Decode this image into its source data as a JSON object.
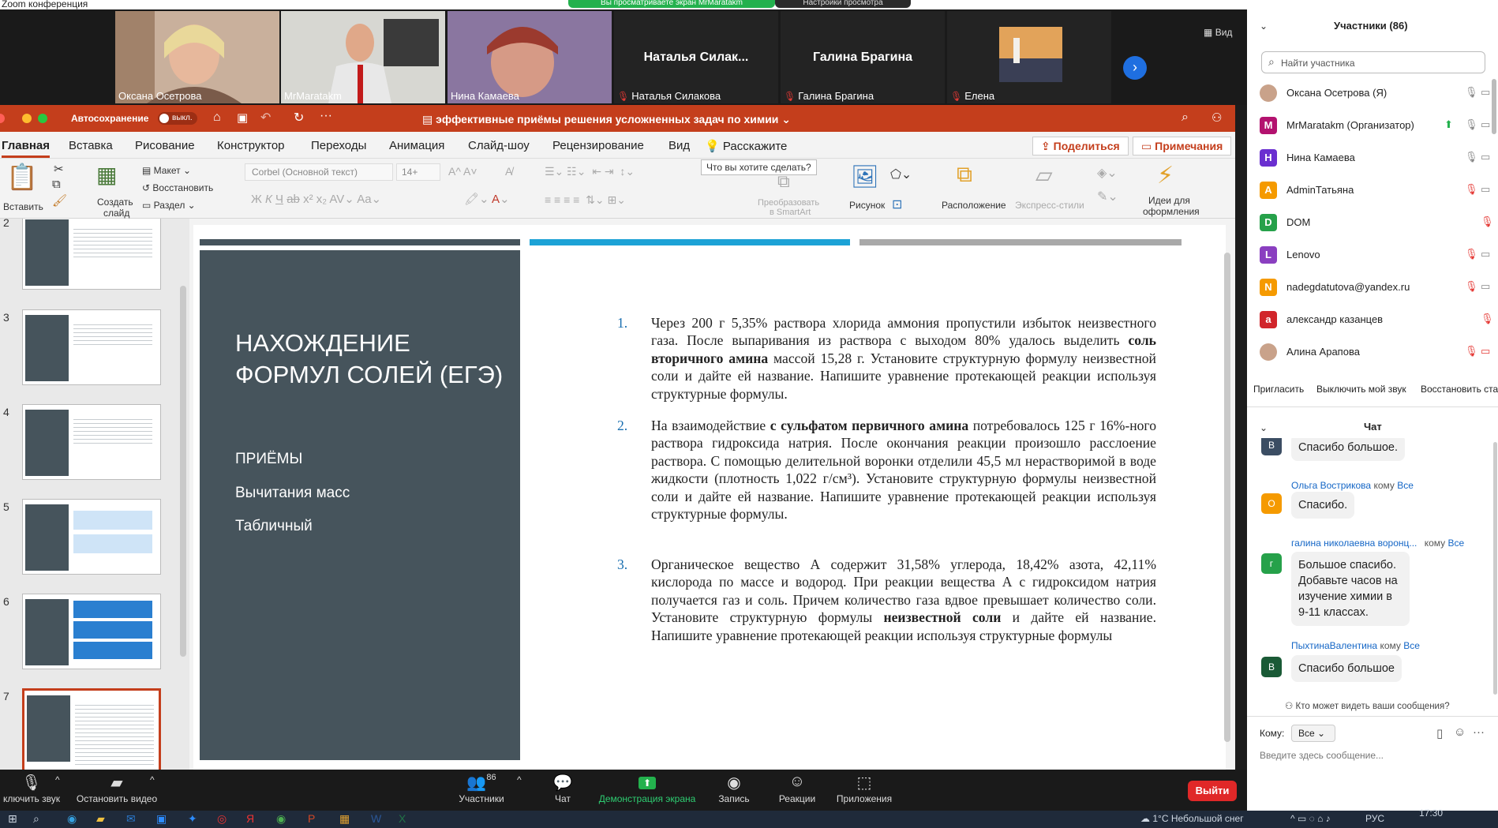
{
  "window": {
    "title": "Zoom конференция",
    "banner": "Вы просматриваете экран MrMaratakm",
    "view_settings": "Настройки просмотра"
  },
  "strip": {
    "view_label": "Вид",
    "tiles": [
      {
        "name": "Оксана Осетрова",
        "muted": false
      },
      {
        "name": "MrMaratakm",
        "muted": false
      },
      {
        "name": "Нина Камаева",
        "muted": false
      },
      {
        "name": "Наталья Силакова",
        "big": "Наталья  Силак...",
        "muted": true
      },
      {
        "name": "Галина Брагина",
        "big": "Галина Брагина",
        "muted": true
      },
      {
        "name": "Елена",
        "muted": true
      }
    ]
  },
  "ppt": {
    "autosave": "Автосохранение",
    "autosave_state": "выкл.",
    "doc_title": "эффективные приёмы решения усложненных задач по химии",
    "tabs": [
      "Главная",
      "Вставка",
      "Рисование",
      "Конструктор",
      "Переходы",
      "Анимация",
      "Слайд-шоу",
      "Рецензирование",
      "Вид",
      "Расскажите"
    ],
    "share": "Поделиться",
    "notes": "Примечания",
    "tooltip": "Что вы хотите сделать?",
    "toolbar": {
      "paste": "Вставить",
      "new_slide_1": "Создать",
      "new_slide_2": "слайд",
      "layout": "Макет",
      "reset": "Восстановить",
      "section": "Раздел",
      "font": "Corbel (Основной текст)",
      "size": "14+",
      "smartart_1": "Преобразовать",
      "smartart_2": "в SmartArt",
      "picture": "Рисунок",
      "arrange": "Расположение",
      "quick_styles": "Экспресс-стили",
      "design_1": "Идеи для",
      "design_2": "оформления"
    },
    "thumb_numbers": [
      "2",
      "3",
      "4",
      "5",
      "6",
      "7"
    ],
    "slide": {
      "title": "НАХОЖДЕНИЕ ФОРМУЛ СОЛЕЙ (ЕГЭ)",
      "subs": [
        "ПРИЁМЫ",
        "Вычитания масс",
        "Табличный"
      ],
      "tasks": [
        {
          "n": "1.",
          "parts": [
            "Через 200 г 5,35% раствора хлорида аммония пропустили избыток неизвестного газа. После выпаривания из раствора с выходом 80% удалось выделить ",
            "соль вторичного амина",
            " массой 15,28 г. Установите структурную формулу неизвестной соли и дайте ей название. Напишите уравнение протекающей реакции используя структурные формулы."
          ]
        },
        {
          "n": "2.",
          "parts": [
            "На взаимодействие ",
            "с сульфатом первичного амина",
            " потребовалось 125 г 16%-ного раствора гидроксида натрия. После окончания реакции произошло расслоение раствора. С помощью делительной воронки отделили 45,5 мл нерастворимой в воде жидкости (плотность 1,022 г/см³). Установите структурную формулы неизвестной соли и дайте ей название. Напишите уравнение протекающей реакции используя структурные формулы."
          ]
        },
        {
          "n": "3.",
          "parts": [
            "Органическое вещество А содержит 31,58% углерода, 18,42% азота, 42,11% кислорода по массе и водород. При реакции вещества А с гидроксидом натрия получается газ и соль. Причем количество газа вдвое превышает количество соли. Установите структурную формулы ",
            "неизвестной соли",
            " и дайте ей название.  Напишите уравнение протекающей реакции используя структурные формулы"
          ]
        }
      ]
    }
  },
  "participants": {
    "header": "Участники (86)",
    "search_placeholder": "Найти участника",
    "list": [
      {
        "name": "Оксана Осетрова (Я)",
        "letter": "",
        "color": "#c9a28a",
        "mic": "on"
      },
      {
        "name": "MrMaratakm (Организатор)",
        "letter": "M",
        "color": "#b3126f",
        "mic": "on"
      },
      {
        "name": "Нина Камаева",
        "letter": "H",
        "color": "#6a2fd0",
        "mic": "on"
      },
      {
        "name": "AdminТатьяна",
        "letter": "A",
        "color": "#f59a00",
        "mic": "off"
      },
      {
        "name": "DOM",
        "letter": "D",
        "color": "#26a14a",
        "mic": "off"
      },
      {
        "name": "Lenovo",
        "letter": "L",
        "color": "#8a3fc0",
        "mic": "off"
      },
      {
        "name": "nadegdatutova@yandex.ru",
        "letter": "N",
        "color": "#f59a00",
        "mic": "off"
      },
      {
        "name": "александр казанцев",
        "letter": "a",
        "color": "#d1252b",
        "mic": "off"
      },
      {
        "name": "Алина Арапова",
        "letter": "",
        "color": "#c9a28a",
        "mic": "off"
      }
    ],
    "invite": "Пригласить",
    "mute_me": "Выключить мой звук",
    "restore": "Восстановить ста"
  },
  "chat": {
    "header": "Чат",
    "messages": [
      {
        "author": "",
        "to": "",
        "letter": "В",
        "color": "#3b4d63",
        "text": "Спасибо большое."
      },
      {
        "author": "Ольга Вострикова",
        "to": "Все",
        "letter": "О",
        "color": "#f59a00",
        "text": "Спасибо."
      },
      {
        "author": "галина николаевна воронц...",
        "to": "Все",
        "letter": "г",
        "color": "#26a14a",
        "text": "Большое спасибо. Добавьте часов на изучение химии в 9-11 классах."
      },
      {
        "author": "ПыхтинаВалентина",
        "to": "Все",
        "letter": "В",
        "color": "#1a5a36",
        "text": "Спасибо большое"
      }
    ],
    "to_word": "кому",
    "who_can_see": "Кто может видеть ваши сообщения?",
    "to_label": "Кому:",
    "to_value": "Все",
    "input_placeholder": "Введите здесь сообщение..."
  },
  "bottom": {
    "mute": "ключить звук",
    "video": "Остановить видео",
    "participants": "Участники",
    "participants_count": "86",
    "chat": "Чат",
    "share": "Демонстрация экрана",
    "record": "Запись",
    "reactions": "Реакции",
    "apps": "Приложения",
    "exit": "Выйти"
  },
  "taskbar": {
    "weather": "1°С  Небольшой снег",
    "lang": "РУС",
    "time": "17:30"
  }
}
